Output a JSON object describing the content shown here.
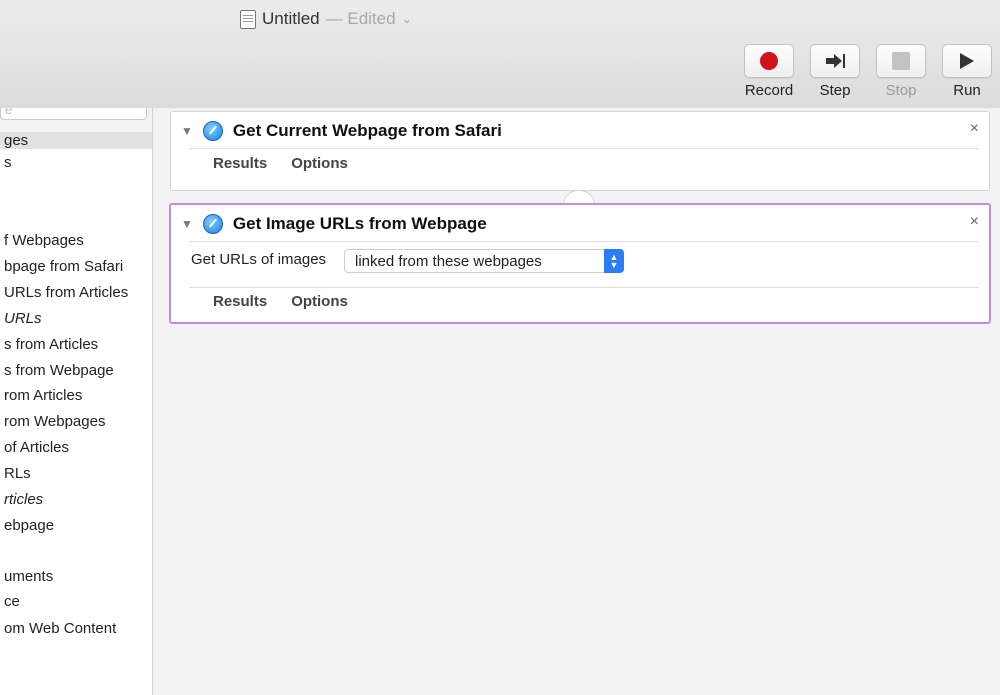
{
  "window": {
    "title": "Untitled",
    "edited": "— Edited",
    "chevron": "⌄"
  },
  "toolbar": {
    "record": "Record",
    "step": "Step",
    "stop": "Stop",
    "run": "Run"
  },
  "sidebar": {
    "search_placeholder": "e",
    "items": [
      "ges",
      "s",
      "f Webpages",
      "bpage from Safari",
      "URLs from Articles",
      "URLs",
      "s from Articles",
      "s from Webpage",
      "rom Articles",
      "rom Webpages",
      "of Articles",
      "RLs",
      "rticles",
      "ebpage",
      "uments",
      "ce",
      "om Web Content"
    ]
  },
  "actions": [
    {
      "title": "Get Current Webpage from Safari",
      "tabs": [
        "Results",
        "Options"
      ],
      "close": "×"
    },
    {
      "title": "Get Image URLs from Webpage",
      "param_label": "Get URLs of images",
      "param_value": "linked from these webpages",
      "tabs": [
        "Results",
        "Options"
      ],
      "close": "×"
    }
  ]
}
